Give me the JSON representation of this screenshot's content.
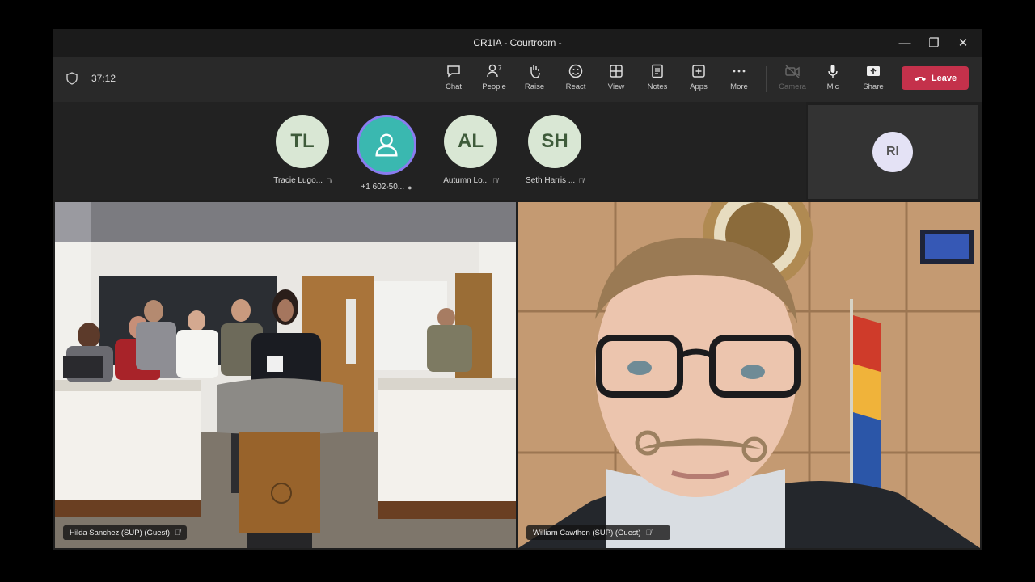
{
  "window": {
    "title": "CR1IA - Courtroom -",
    "controls": [
      "—",
      "❐",
      "✕"
    ]
  },
  "toolbar": {
    "timer": "37:12",
    "buttons": {
      "chat": "Chat",
      "people": "People",
      "people_count": "7",
      "raise": "Raise",
      "react": "React",
      "view": "View",
      "notes": "Notes",
      "apps": "Apps",
      "more": "More",
      "camera": "Camera",
      "mic": "Mic",
      "share": "Share"
    },
    "leave_label": "Leave"
  },
  "participants": [
    {
      "initials": "TL",
      "name": "Tracie Lugo..."
    },
    {
      "initials": "",
      "name": "+1 602-50..."
    },
    {
      "initials": "AL",
      "name": "Autumn Lo..."
    },
    {
      "initials": "SH",
      "name": "Seth Harris ..."
    }
  ],
  "side_tile": {
    "initials": "RI"
  },
  "video_tiles": [
    {
      "name": "Hilda Sanchez (SUP) (Guest)"
    },
    {
      "name": "William Cawthon (SUP) (Guest)",
      "more": "···"
    }
  ],
  "colors": {
    "leave": "#c4314b",
    "teal_avatar": "#3ab8b0",
    "ring": "#8a7cf0"
  }
}
